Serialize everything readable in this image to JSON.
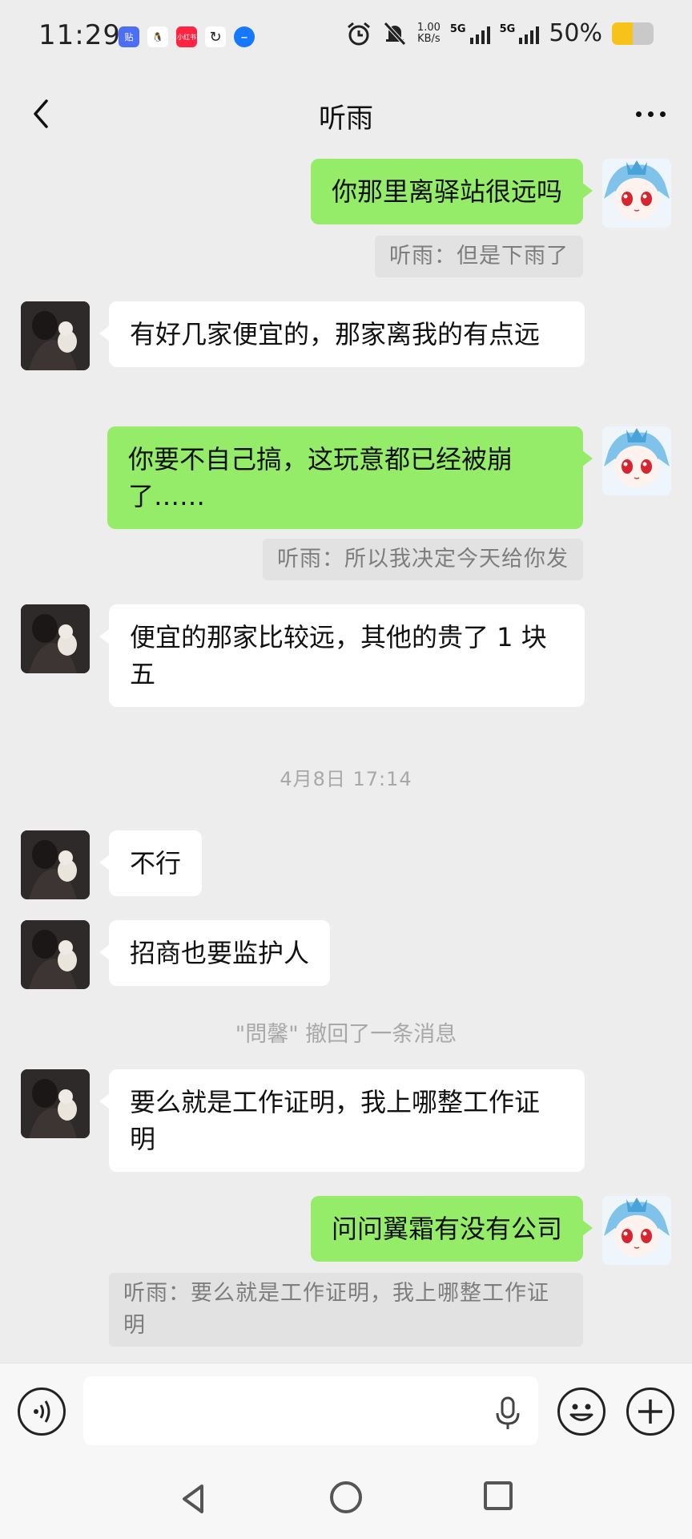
{
  "status_bar": {
    "time": "11:29",
    "apps": [
      {
        "icon": "tieba-app-icon",
        "label": "贴",
        "color": "#4c6ef5"
      },
      {
        "icon": "qq-app-icon",
        "label": "🐧",
        "color": "#ffffff"
      },
      {
        "icon": "xiaohongshu-app-icon",
        "label": "小红书",
        "color": "#ff2442"
      },
      {
        "icon": "sync-app-icon",
        "label": "↻",
        "color": "#ffffff"
      },
      {
        "icon": "message-app-icon",
        "label": "–",
        "color": "#1677ff"
      }
    ],
    "net_speed_value": "1.00",
    "net_speed_unit": "KB/s",
    "signal_1": "5G",
    "signal_2": "5G",
    "battery_percent": "50%",
    "battery_level": 0.5
  },
  "header": {
    "title": "听雨"
  },
  "messages": [
    {
      "sender": "me",
      "text": "你那里离驿站很远吗",
      "quote": "听雨：但是下雨了"
    },
    {
      "sender": "other",
      "text": "有好几家便宜的，那家离我的有点远"
    },
    {
      "sender": "me",
      "text": "你要不自己搞，这玩意都已经被崩了……",
      "quote": "听雨：所以我决定今天给你发"
    },
    {
      "sender": "other",
      "text": "便宜的那家比较远，其他的贵了 1 块五"
    },
    {
      "sender": "other",
      "text": "不行"
    },
    {
      "sender": "other",
      "text": "招商也要监护人"
    },
    {
      "sender": "other",
      "text": "要么就是工作证明，我上哪整工作证明"
    },
    {
      "sender": "me",
      "text": "问问翼霜有没有公司",
      "quote": "听雨：要么就是工作证明，我上哪整工作证明"
    }
  ],
  "timestamp": "4月8日 17:14",
  "recall_notice": "\"問馨\" 撤回了一条消息",
  "input": {
    "placeholder": "",
    "value": ""
  },
  "colors": {
    "my_bubble": "#95ec69",
    "other_bubble": "#ffffff",
    "background": "#ededed"
  }
}
